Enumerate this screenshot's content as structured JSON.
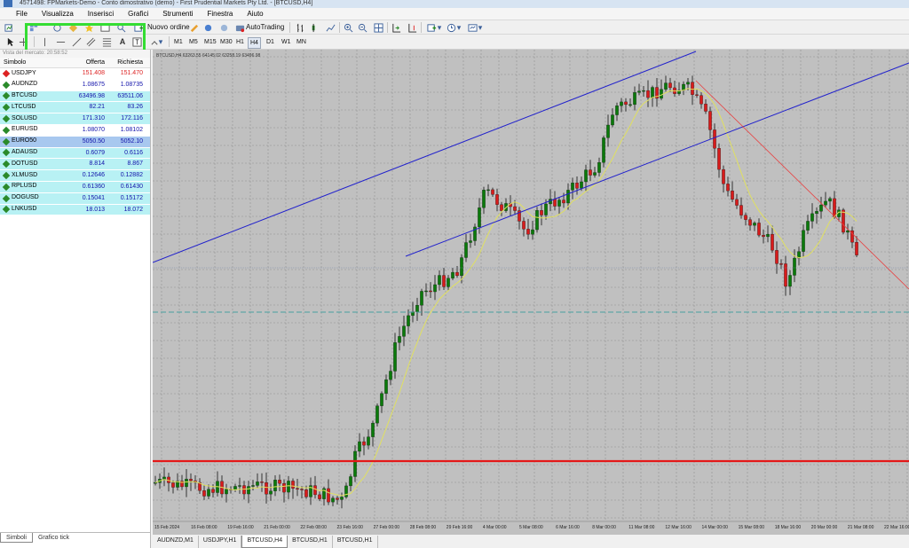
{
  "titlebar": {
    "text": "4571498: FPMarkets-Demo - Conto dimostrativo (demo) - First Prudential Markets Pty Ltd. - [BTCUSD,H4]"
  },
  "menu": [
    "File",
    "Visualizza",
    "Inserisci",
    "Grafici",
    "Strumenti",
    "Finestra",
    "Aiuto"
  ],
  "toolbar": {
    "new_order_label": "Nuovo ordine",
    "autotrading_label": "AutoTrading",
    "timeframes": [
      "M1",
      "M5",
      "M15",
      "M30",
      "H1",
      "H4",
      "D1",
      "W1",
      "MN"
    ],
    "active_timeframe": "H4"
  },
  "market_watch": {
    "title": "Vista del mercato: 20:58:52",
    "columns": [
      "Simbolo",
      "Offerta",
      "Richiesta"
    ],
    "rows": [
      {
        "symbol": "USDJPY",
        "bid": "151.408",
        "ask": "151.470",
        "style": "white",
        "color": "#d22"
      },
      {
        "symbol": "AUDNZD",
        "bid": "1.08675",
        "ask": "1.08735",
        "style": "white",
        "color": "#11a"
      },
      {
        "symbol": "BTCUSD",
        "bid": "63496.98",
        "ask": "63511.06",
        "style": "cyan",
        "color": "#11a"
      },
      {
        "symbol": "LTCUSD",
        "bid": "82.21",
        "ask": "83.26",
        "style": "cyan",
        "color": "#11a"
      },
      {
        "symbol": "SOLUSD",
        "bid": "171.310",
        "ask": "172.116",
        "style": "cyan",
        "color": "#11a"
      },
      {
        "symbol": "EURUSD",
        "bid": "1.08070",
        "ask": "1.08102",
        "style": "white",
        "color": "#11a"
      },
      {
        "symbol": "EURO50",
        "bid": "5050.50",
        "ask": "5052.10",
        "style": "sel",
        "color": "#11a"
      },
      {
        "symbol": "ADAUSD",
        "bid": "0.6079",
        "ask": "0.6116",
        "style": "cyan",
        "color": "#11a"
      },
      {
        "symbol": "DOTUSD",
        "bid": "8.814",
        "ask": "8.867",
        "style": "cyan",
        "color": "#11a"
      },
      {
        "symbol": "XLMUSD",
        "bid": "0.12646",
        "ask": "0.12882",
        "style": "cyan",
        "color": "#11a"
      },
      {
        "symbol": "RPLUSD",
        "bid": "0.61360",
        "ask": "0.61430",
        "style": "cyan",
        "color": "#11a"
      },
      {
        "symbol": "DOGUSD",
        "bid": "0.15041",
        "ask": "0.15172",
        "style": "cyan",
        "color": "#11a"
      },
      {
        "symbol": "LNKUSD",
        "bid": "18.013",
        "ask": "18.072",
        "style": "cyan",
        "color": "#11a"
      }
    ],
    "tabs": [
      "Simboli",
      "Grafico tick"
    ],
    "active_tab": "Simboli"
  },
  "chart": {
    "info": "BTCUSD,H4  63263.55 64145.02 63258.19 63496.98",
    "x_labels": [
      "15 Feb 2024",
      "16 Feb 08:00",
      "19 Feb 16:00",
      "21 Feb 00:00",
      "22 Feb 08:00",
      "23 Feb 16:00",
      "27 Feb 00:00",
      "28 Feb 08:00",
      "29 Feb 16:00",
      "4 Mar 00:00",
      "5 Mar 08:00",
      "6 Mar 16:00",
      "8 Mar 00:00",
      "11 Mar 08:00",
      "12 Mar 16:00",
      "14 Mar 00:00",
      "15 Mar 08:00",
      "18 Mar 16:00",
      "20 Mar 00:00",
      "21 Mar 08:00",
      "22 Mar 16:00"
    ],
    "colors": {
      "up": "#0a7a0a",
      "down": "#d81b1b",
      "ma": "#e0e060",
      "channel": "#2222cc",
      "trendline": "#e84040",
      "support": "#e41818",
      "hline": "#48a0a0",
      "grid": "#909090",
      "bg": "#c0c0c0"
    }
  },
  "chart_tabs": [
    "AUDNZD,M1",
    "USDJPY,H1",
    "BTCUSD,H4",
    "BTCUSD,H1",
    "BTCUSD,H1"
  ],
  "active_chart_tab": "BTCUSD,H4"
}
